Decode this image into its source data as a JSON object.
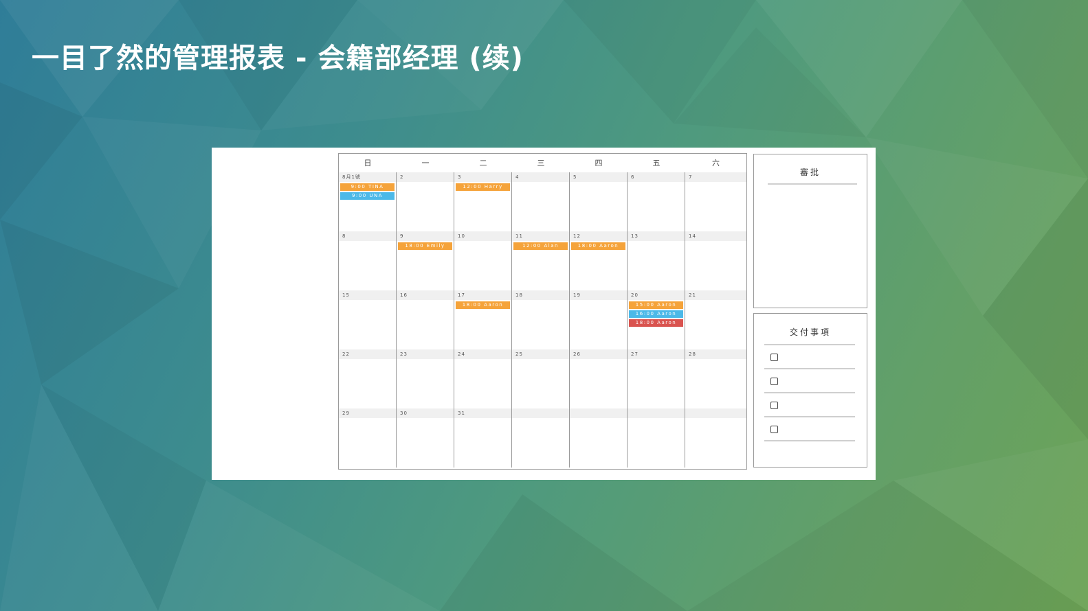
{
  "slide": {
    "title": "一目了然的管理报表 - 会籍部经理 (续)"
  },
  "colors": {
    "orange": "#f5a33a",
    "blue": "#4cb9e8",
    "red": "#d9534f"
  },
  "calendar": {
    "weekdays": [
      "日",
      "一",
      "二",
      "三",
      "四",
      "五",
      "六"
    ],
    "weeks": [
      [
        {
          "date": "8月1號",
          "events": [
            {
              "text": "9:00 TINA",
              "color": "orange"
            },
            {
              "text": "9:00 UNA",
              "color": "blue"
            }
          ]
        },
        {
          "date": "2",
          "events": []
        },
        {
          "date": "3",
          "events": [
            {
              "text": "12:00 Harry",
              "color": "orange"
            }
          ]
        },
        {
          "date": "4",
          "events": []
        },
        {
          "date": "5",
          "events": []
        },
        {
          "date": "6",
          "events": []
        },
        {
          "date": "7",
          "events": []
        }
      ],
      [
        {
          "date": "8",
          "events": []
        },
        {
          "date": "9",
          "events": [
            {
              "text": "18:00 Emily",
              "color": "orange"
            }
          ]
        },
        {
          "date": "10",
          "events": []
        },
        {
          "date": "11",
          "events": [
            {
              "text": "12:00 Alan",
              "color": "orange"
            }
          ]
        },
        {
          "date": "12",
          "events": [
            {
              "text": "18:00 Aaron",
              "color": "orange"
            }
          ]
        },
        {
          "date": "13",
          "events": []
        },
        {
          "date": "14",
          "events": []
        }
      ],
      [
        {
          "date": "15",
          "events": []
        },
        {
          "date": "16",
          "events": []
        },
        {
          "date": "17",
          "events": [
            {
              "text": "18:00 Aaron",
              "color": "orange"
            }
          ]
        },
        {
          "date": "18",
          "events": []
        },
        {
          "date": "19",
          "events": []
        },
        {
          "date": "20",
          "events": [
            {
              "text": "15:00 Aaron",
              "color": "orange"
            },
            {
              "text": "16:00 Aaron",
              "color": "blue"
            },
            {
              "text": "18:00 Aaron",
              "color": "red"
            }
          ]
        },
        {
          "date": "21",
          "events": []
        }
      ],
      [
        {
          "date": "22",
          "events": []
        },
        {
          "date": "23",
          "events": []
        },
        {
          "date": "24",
          "events": []
        },
        {
          "date": "25",
          "events": []
        },
        {
          "date": "26",
          "events": []
        },
        {
          "date": "27",
          "events": []
        },
        {
          "date": "28",
          "events": []
        }
      ],
      [
        {
          "date": "29",
          "events": []
        },
        {
          "date": "30",
          "events": []
        },
        {
          "date": "31",
          "events": []
        },
        {
          "date": "",
          "events": []
        },
        {
          "date": "",
          "events": []
        },
        {
          "date": "",
          "events": []
        },
        {
          "date": "",
          "events": []
        }
      ]
    ]
  },
  "approval_panel": {
    "title": "審批"
  },
  "deliverables_panel": {
    "title": "交付事項",
    "items": [
      {
        "checked": false
      },
      {
        "checked": false
      },
      {
        "checked": false
      },
      {
        "checked": false
      }
    ]
  }
}
